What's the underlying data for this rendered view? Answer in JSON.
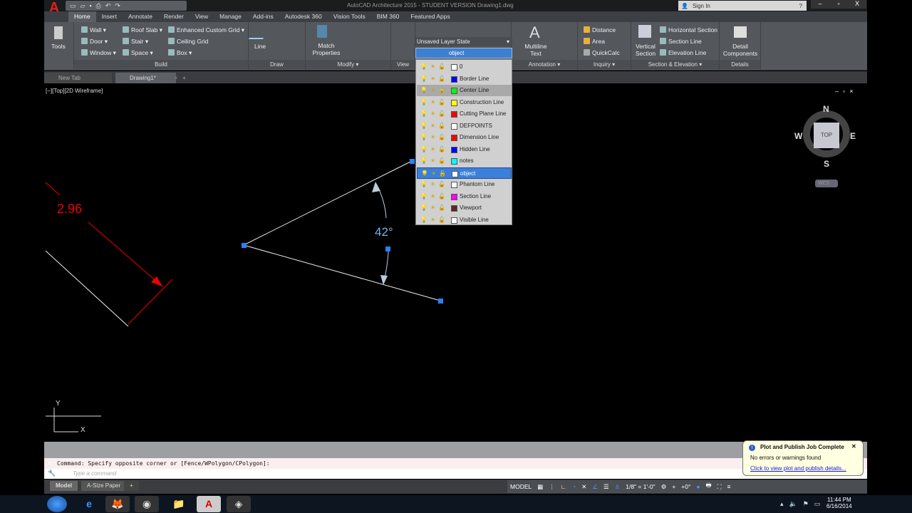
{
  "app": {
    "title": "AutoCAD Architecture 2015 - STUDENT VERSION    Drawing1.dwg",
    "sign_in": "Sign In",
    "window_controls": [
      "–",
      "▫",
      "X"
    ]
  },
  "ribbon_tabs": [
    "Home",
    "Insert",
    "Annotate",
    "Render",
    "View",
    "Manage",
    "Add-ins",
    "Autodesk 360",
    "Vision Tools",
    "BIM 360",
    "Featured Apps"
  ],
  "active_tab": "Home",
  "panels": {
    "tools": {
      "label": "Tools"
    },
    "build": {
      "title": "Build",
      "items": [
        "Wall",
        "Door",
        "Window",
        "Roof Slab",
        "Stair",
        "Space",
        "Enhanced Custom Grid",
        "Ceiling Grid",
        "Box"
      ]
    },
    "draw": {
      "title": "Draw",
      "line": "Line"
    },
    "modify": {
      "title": "Modify",
      "match": "Match Properties"
    },
    "view": {
      "title": "View"
    },
    "annotation": {
      "title": "Annotation",
      "mtext": "Multiline Text"
    },
    "inquiry": {
      "title": "Inquiry",
      "items": [
        "Distance",
        "Area",
        "QuickCalc"
      ]
    },
    "section": {
      "title": "Section & Elevation",
      "vertical": "Vertical Section",
      "items": [
        "Horizontal Section",
        "Section Line",
        "Elevation Line"
      ]
    },
    "details": {
      "title": "Details",
      "detail": "Detail Components"
    }
  },
  "file_tabs": [
    "New Tab",
    "Drawing1*"
  ],
  "viewport": {
    "label": "[−][Top][2D Wireframe]",
    "dimension": "2.96",
    "angle": "42°"
  },
  "viewcube": {
    "n": "N",
    "s": "S",
    "e": "E",
    "w": "W",
    "face": "TOP",
    "wcs": "WCS"
  },
  "layers": {
    "state": "Unsaved Layer State",
    "current": "object",
    "list": [
      {
        "name": "0",
        "color": "#ffffff"
      },
      {
        "name": "Border Line",
        "color": "#0000ff"
      },
      {
        "name": "Center Line",
        "color": "#00ff00"
      },
      {
        "name": "Construction Line",
        "color": "#ffff00"
      },
      {
        "name": "Cutting Plane Line",
        "color": "#ff0000"
      },
      {
        "name": "DEFPOINTS",
        "color": "#ffffff"
      },
      {
        "name": "Dimension Line",
        "color": "#ff0000"
      },
      {
        "name": "Hidden Line",
        "color": "#0000ff"
      },
      {
        "name": "notes",
        "color": "#00ffff"
      },
      {
        "name": "object",
        "color": "#ffffff"
      },
      {
        "name": "Phantom Line",
        "color": "#ffffff"
      },
      {
        "name": "Section Line",
        "color": "#ff00ff"
      },
      {
        "name": "Viewport",
        "color": "#5a2a2a"
      },
      {
        "name": "Visible Line",
        "color": "#ffffff"
      }
    ]
  },
  "command": {
    "history": "Command: Specify opposite corner or [Fence/WPolygon/CPolygon]:",
    "placeholder": "Type a command"
  },
  "layout_tabs": [
    "Model",
    "A-Size Paper",
    "+"
  ],
  "status": {
    "model": "MODEL",
    "scale": "1/8\" = 1'-0\"",
    "angle": "+0°"
  },
  "notification": {
    "title": "Plot and Publish Job Complete",
    "body": "No errors or warnings found",
    "link": "Click to view plot and publish details..."
  },
  "clock": {
    "time": "11:44 PM",
    "date": "6/16/2014"
  }
}
